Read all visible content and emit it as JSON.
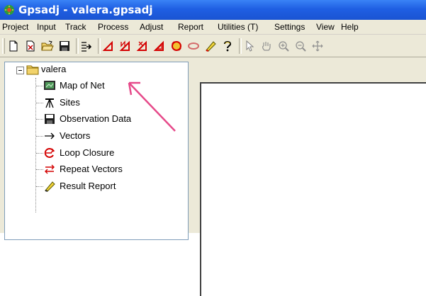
{
  "window": {
    "title": "Gpsadj - valera.gpsadj"
  },
  "menubar": {
    "items": [
      "Project",
      "Input",
      "Track",
      "Process",
      "Adjust",
      "Report",
      "Utilities (T)",
      "Settings",
      "View",
      "Help"
    ]
  },
  "toolbar": {
    "buttons": [
      "new-file-icon",
      "close-file-icon",
      "open-folder-icon",
      "save-disk-icon",
      "import-arrow-icon",
      "triangle-tool-icon",
      "triangle-n-icon",
      "triangle-x-icon",
      "triangle-double-icon",
      "loop-icon",
      "repeat-icon",
      "pencil-icon",
      "question-icon",
      "pointer-icon",
      "hand-pan-icon",
      "zoom-in-icon",
      "zoom-out-icon",
      "move-icon"
    ]
  },
  "tree": {
    "root": "valera",
    "items": [
      "Map of Net",
      "Sites",
      "Observation Data",
      "Vectors",
      "Loop Closure",
      "Repeat Vectors",
      "Result Report"
    ]
  },
  "colors": {
    "titlebar": "#1f5fe3",
    "chrome": "#ece9d8",
    "annotation_arrow": "#e64a8a"
  }
}
